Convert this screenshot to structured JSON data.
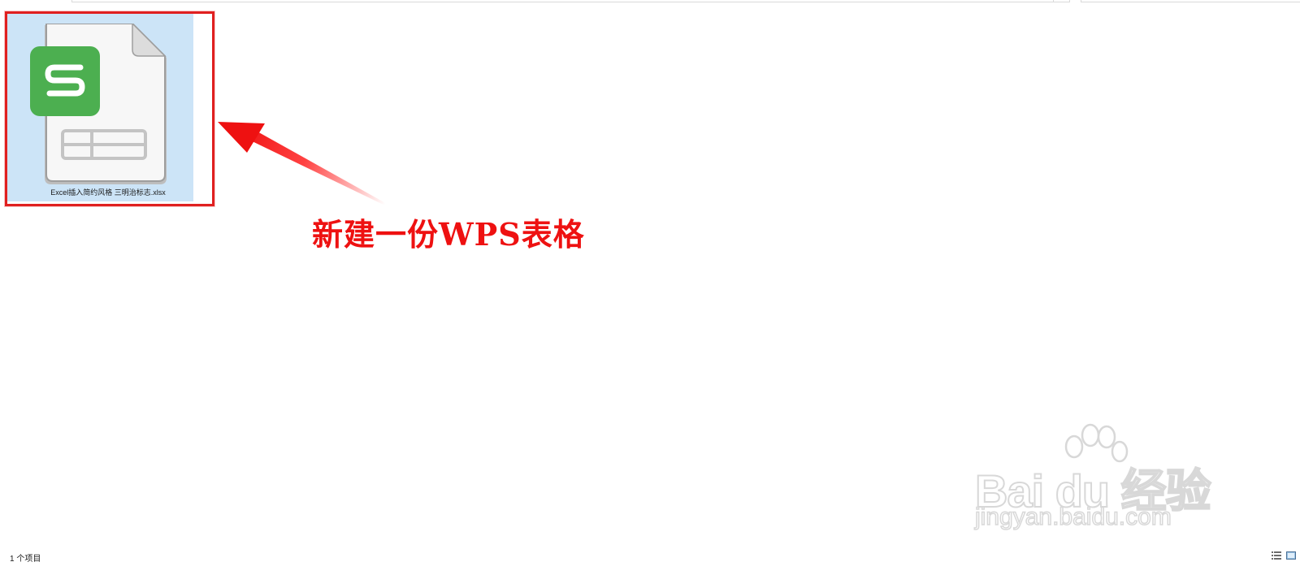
{
  "file": {
    "name": "Excel插入简约风格 三明治标志.xlsx",
    "icon": "wps-spreadsheet-icon",
    "icon_letter": "S",
    "selected": true
  },
  "annotation": {
    "text": "新建一份WPS表格",
    "color": "#ee1111"
  },
  "status_bar": {
    "item_count": "1 个项目"
  },
  "watermark": {
    "brand": "Bai du 经验",
    "url": "jingyan.baidu.com"
  },
  "colors": {
    "selection": "#cce4f7",
    "wps_green": "#4caf50",
    "highlight_red": "#e02020"
  }
}
